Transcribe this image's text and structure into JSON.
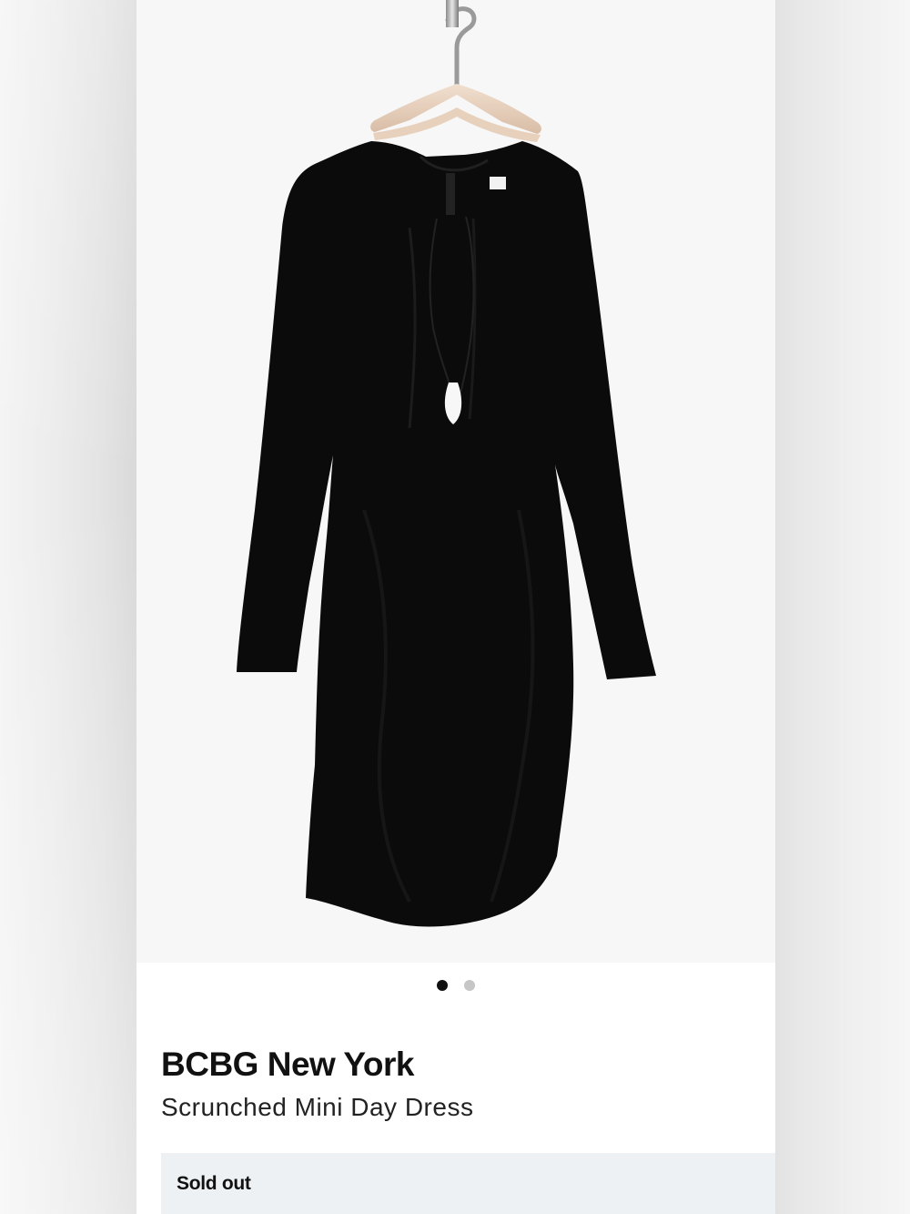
{
  "product": {
    "brand": "BCBG New York",
    "name": "Scrunched Mini Day Dress",
    "availability": "Sold out"
  },
  "gallery": {
    "image_count": 2,
    "active_index": 0,
    "image_subject": "black-long-sleeve-dress-on-hanger-icon"
  },
  "colors": {
    "dress": "#0a0a0a",
    "status_background": "#edf1f3",
    "dot_active": "#111111",
    "dot_inactive": "#c6c6c6"
  }
}
